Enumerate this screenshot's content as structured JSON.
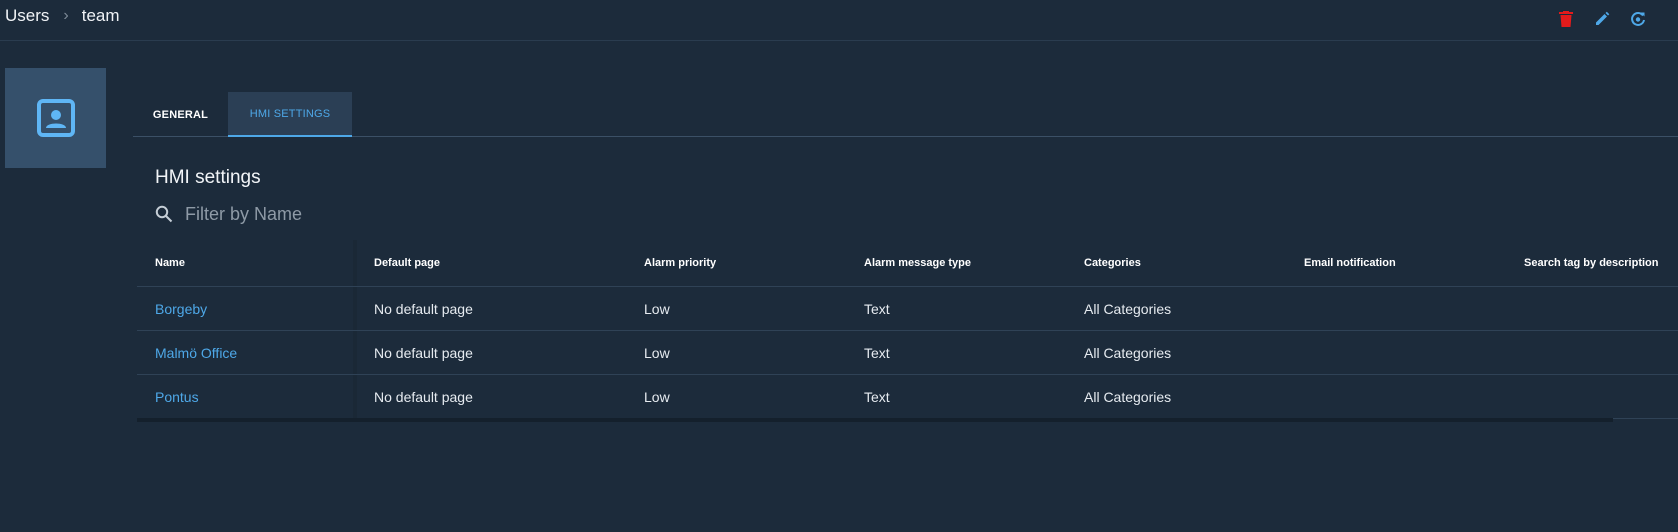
{
  "breadcrumb": {
    "root": "Users",
    "current": "team"
  },
  "header_icons": [
    "delete-icon",
    "edit-icon",
    "refresh-icon"
  ],
  "colors": {
    "background": "#1c2b3b",
    "accent": "#4ea8e8",
    "danger": "#e31b1b",
    "avatar_bg": "#35506b"
  },
  "tabs": [
    {
      "label": "GENERAL",
      "active": false
    },
    {
      "label": "HMI SETTINGS",
      "active": true
    }
  ],
  "section": {
    "title": "HMI settings"
  },
  "filter": {
    "placeholder": "Filter by Name",
    "value": ""
  },
  "table": {
    "columns": [
      "Name",
      "Default page",
      "Alarm priority",
      "Alarm message type",
      "Categories",
      "Email notification",
      "Search tag by description"
    ],
    "rows": [
      [
        "Borgeby",
        "No default page",
        "Low",
        "Text",
        "All Categories",
        "",
        ""
      ],
      [
        "Malmö Office",
        "No default page",
        "Low",
        "Text",
        "All Categories",
        "",
        ""
      ],
      [
        "Pontus",
        "No default page",
        "Low",
        "Text",
        "All Categories",
        "",
        ""
      ]
    ]
  }
}
